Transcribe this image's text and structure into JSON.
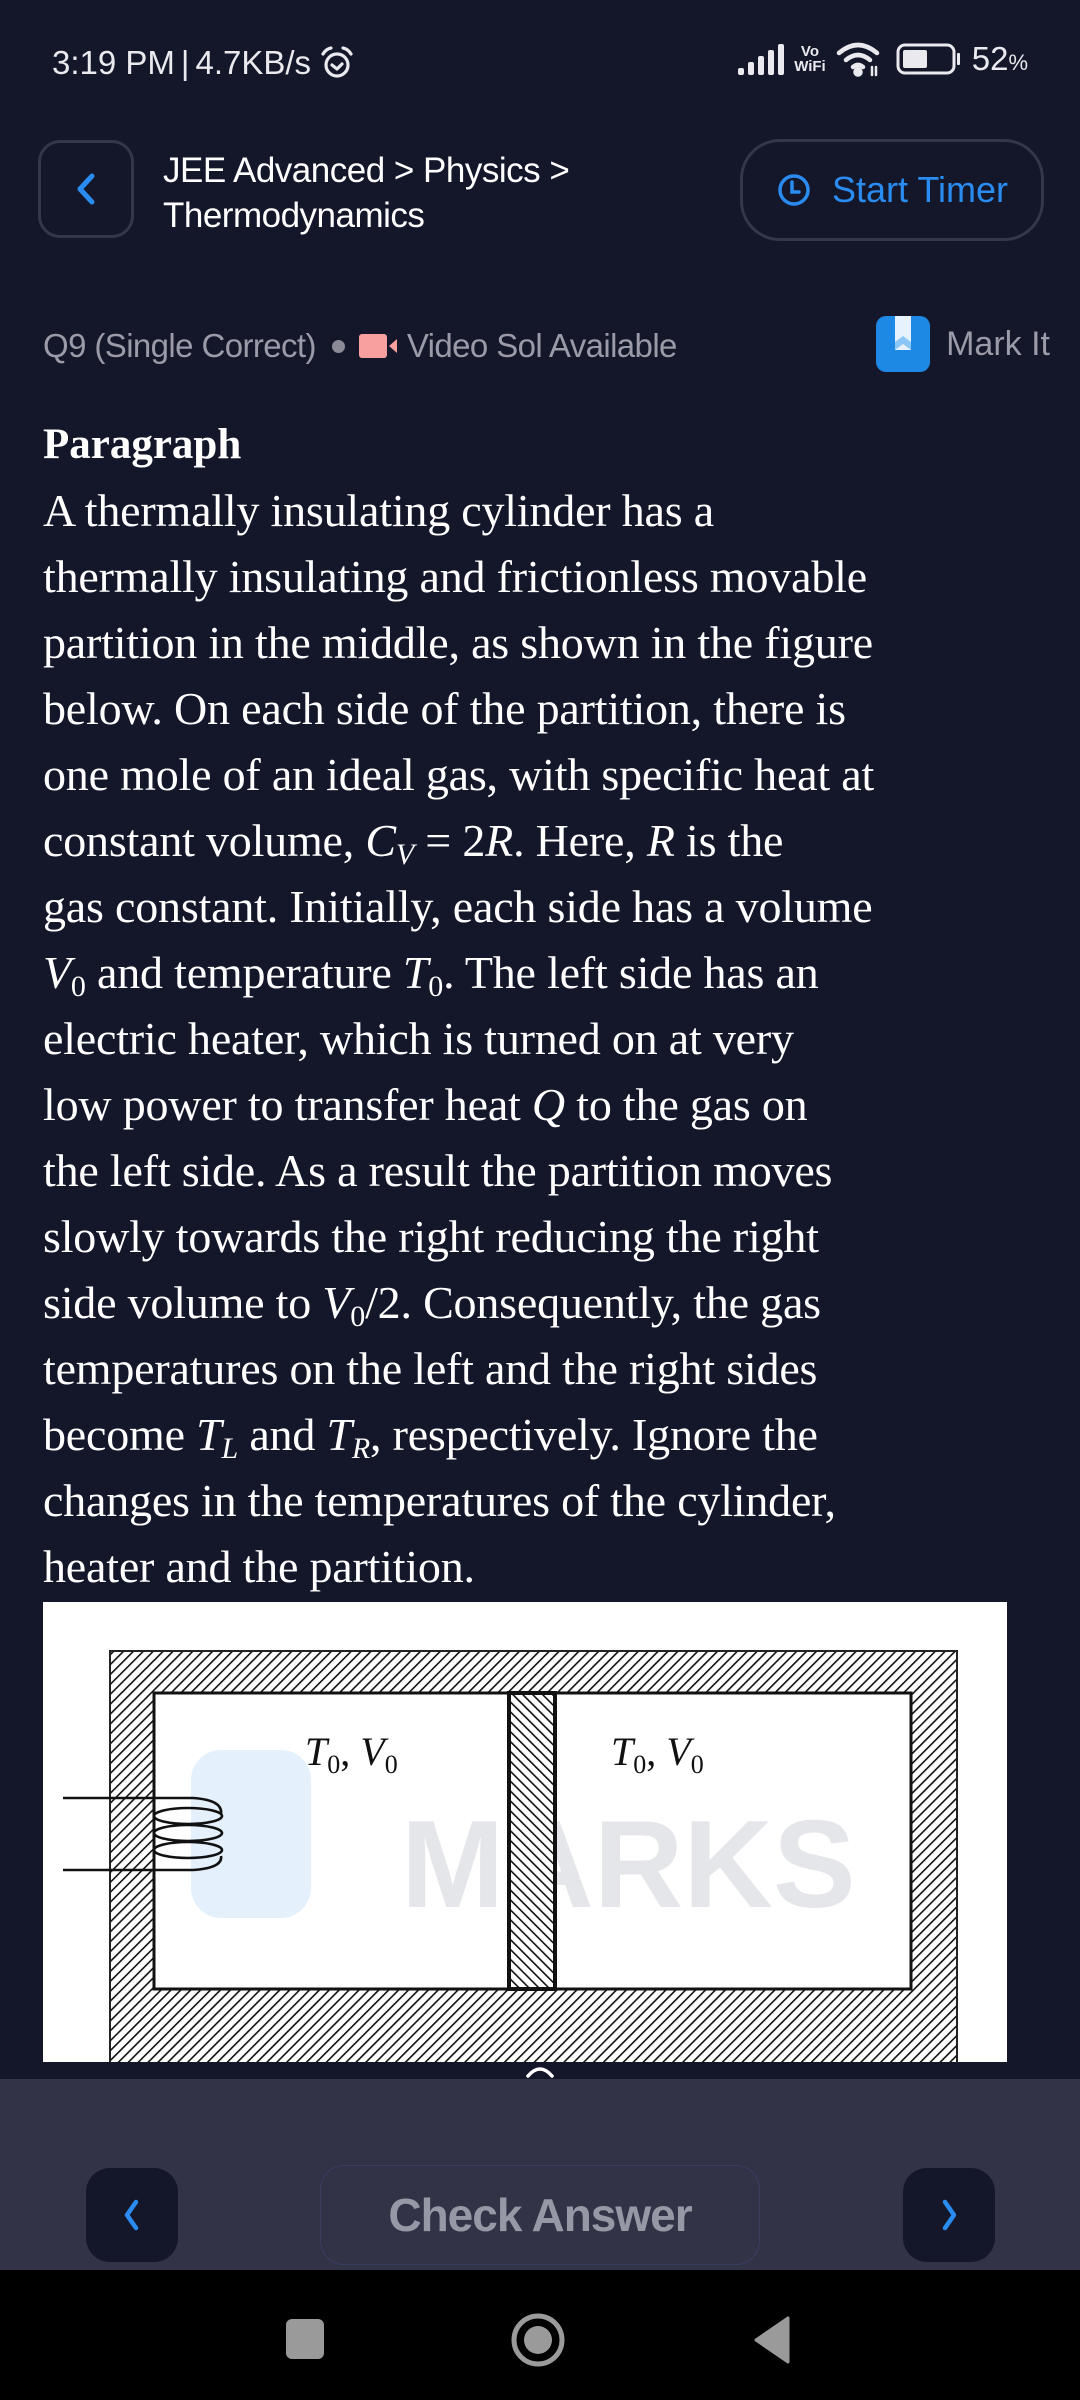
{
  "status_bar": {
    "time": "3:19 PM",
    "separator": "|",
    "net_speed": "4.7KB/s",
    "alarm_icon": "alarm-clock-icon",
    "signal_icon": "cellular-signal-icon",
    "vowifi_top": "Vo",
    "vowifi_bottom": "WiFi",
    "wifi_icon": "wifi-icon",
    "battery_icon": "battery-icon",
    "battery_level": 0.52,
    "battery_percent": "52",
    "battery_percent_sign": "%"
  },
  "header": {
    "back_icon": "chevron-left-icon",
    "breadcrumb_line1": "JEE Advanced > Physics >",
    "breadcrumb_line2": "Thermodynamics",
    "timer_icon": "clock-icon",
    "timer_label": "Start Timer"
  },
  "question_meta": {
    "question_label": "Q9 (Single Correct)",
    "video_icon": "video-camera-icon",
    "video_label": "Video Sol Available",
    "bookmark_icon": "bookmark-icon",
    "mark_label": "Mark It"
  },
  "paragraph": {
    "heading": "Paragraph",
    "lines": [
      [
        "A thermally insulating cylinder has a"
      ],
      [
        "thermally insulating and frictionless movable"
      ],
      [
        "partition in the middle, as shown in the figure"
      ],
      [
        "below. On each side of the partition, there is"
      ],
      [
        "one mole of an ideal gas, with specific heat at"
      ],
      [
        "constant volume, ",
        {
          "m": "C",
          "sub": "V",
          "subItalic": true
        },
        {
          "t": " = 2"
        },
        {
          "m": "R"
        },
        ". Here, ",
        {
          "m": "R"
        },
        " is the"
      ],
      [
        "gas constant. Initially, each side has a volume"
      ],
      [
        {
          "m": "V",
          "sub": "0"
        },
        " and temperature ",
        {
          "m": "T",
          "sub": "0"
        },
        ". The left side has an"
      ],
      [
        "electric heater, which is turned on at very"
      ],
      [
        "low power to transfer heat ",
        {
          "m": "Q"
        },
        " to the gas on"
      ],
      [
        "the left side. As a result the partition moves"
      ],
      [
        "slowly towards the right reducing the right"
      ],
      [
        "side volume to ",
        {
          "m": "V",
          "sub": "0"
        },
        {
          "t": "/2"
        },
        ". Consequently, the gas"
      ],
      [
        "temperatures on the left and the right sides"
      ],
      [
        "become ",
        {
          "m": "T",
          "sub": "L",
          "subItalic": true
        },
        " and ",
        {
          "m": "T",
          "sub": "R",
          "subItalic": true
        },
        ", respectively. Ignore the"
      ],
      [
        "changes in the temperatures of the cylinder,"
      ],
      [
        "heater and the partition."
      ]
    ]
  },
  "figure": {
    "left_label_main": "T",
    "left_label_sub": "0",
    "left_label_main2": "V",
    "left_label_sub2": "0",
    "right_label_main": "T",
    "right_label_sub": "0",
    "right_label_main2": "V",
    "right_label_sub2": "0",
    "watermark": "MARKS"
  },
  "footer": {
    "collapse_icon": "chevron-up-icon",
    "prev_icon": "chevron-left-icon",
    "check_label": "Check Answer",
    "next_icon": "chevron-right-icon"
  },
  "system_nav": {
    "recents_icon": "recents-square-icon",
    "home_icon": "home-circle-icon",
    "back_icon": "back-triangle-icon"
  },
  "colors": {
    "background": "#14162a",
    "accent": "#2a8cf0",
    "muted_text": "#9a9aa8",
    "video_icon": "#f8a0a0",
    "action_bar": "#323347",
    "check_text": "#9698a6"
  }
}
